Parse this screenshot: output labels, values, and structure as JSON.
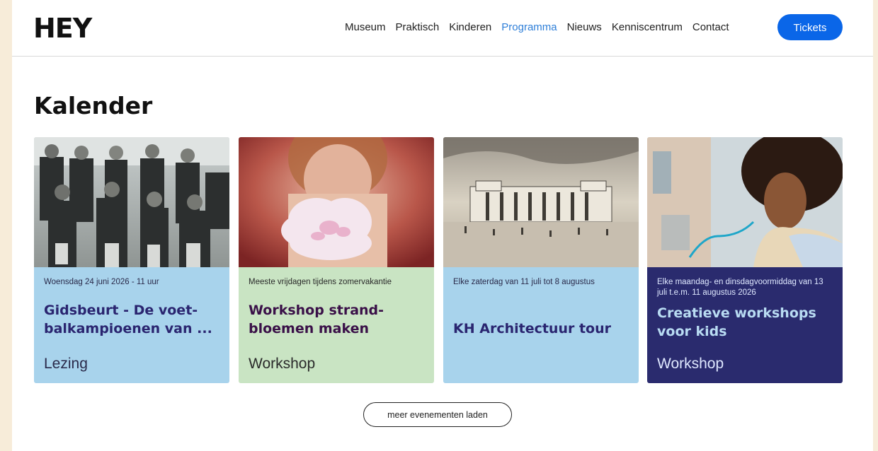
{
  "header": {
    "logo": "HEY",
    "nav": [
      {
        "label": "Museum"
      },
      {
        "label": "Praktisch"
      },
      {
        "label": "Kinderen"
      },
      {
        "label": "Programma",
        "active": true
      },
      {
        "label": "Nieuws"
      },
      {
        "label": "Kenniscentrum"
      },
      {
        "label": "Contact"
      }
    ],
    "tickets_label": "Tickets"
  },
  "main": {
    "title": "Kalender",
    "cards": [
      {
        "date": "Woensdag 24 juni 2026 - 11 uur",
        "title": "Gidsbeurt - De voet-balkampioenen van ...",
        "category": "Lezing",
        "image": "vintage-football-team-photo",
        "bg": "#a8d3ec",
        "title_color": "#2a2570",
        "text_color": "#2a2a4a"
      },
      {
        "date": "Meeste vrijdagen tijdens zomervakantie",
        "title": "Workshop strand-bloemen maken",
        "category": "Workshop",
        "image": "child-with-paper-flower-photo",
        "bg": "#c9e4c3",
        "title_color": "#3a1048",
        "text_color": "#2a2a2a"
      },
      {
        "date": "Elke zaterdag van 11 juli tot 8 augustus",
        "title": "KH Architectuur tour",
        "category": "",
        "image": "historic-building-sepia-photo",
        "bg": "#a8d3ec",
        "title_color": "#2a2570",
        "text_color": "#2a2a4a"
      },
      {
        "date": "Elke maandag- en dinsdagvoormiddag van 13 juli t.e.m. 11 augustus 2026",
        "title": "Creatieve workshops voor kids",
        "category": "Workshop",
        "image": "child-drawing-photo",
        "bg": "#2a2b6e",
        "title_color": "#b9dcf3",
        "text_color": "#dfe8ff"
      }
    ],
    "load_more_label": "meer evenementen laden"
  }
}
